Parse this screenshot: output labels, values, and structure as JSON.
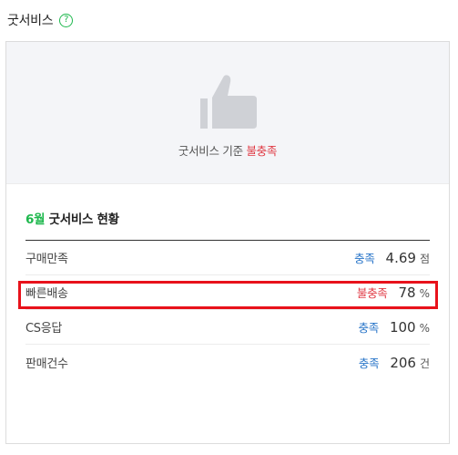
{
  "header": {
    "title": "굿서비스",
    "help_icon": "question-circle-icon"
  },
  "hero": {
    "icon": "thumbs-up-icon",
    "text_prefix": "굿서비스 기준 ",
    "text_status": "불충족"
  },
  "section": {
    "month": "6월",
    "title": " 굿서비스 현황"
  },
  "metrics": [
    {
      "label": "구매만족",
      "status": "충족",
      "value": "4.69",
      "unit": "점"
    },
    {
      "label": "빠른배송",
      "status": "불충족",
      "value": "78",
      "unit": "%"
    },
    {
      "label": "CS응답",
      "status": "충족",
      "value": "100",
      "unit": "%"
    },
    {
      "label": "판매건수",
      "status": "충족",
      "value": "206",
      "unit": "건"
    }
  ],
  "colors": {
    "accent_green": "#1fb84e",
    "status_ok": "#2a76c9",
    "status_bad": "#e03a44",
    "highlight_box": "#e8121b"
  }
}
